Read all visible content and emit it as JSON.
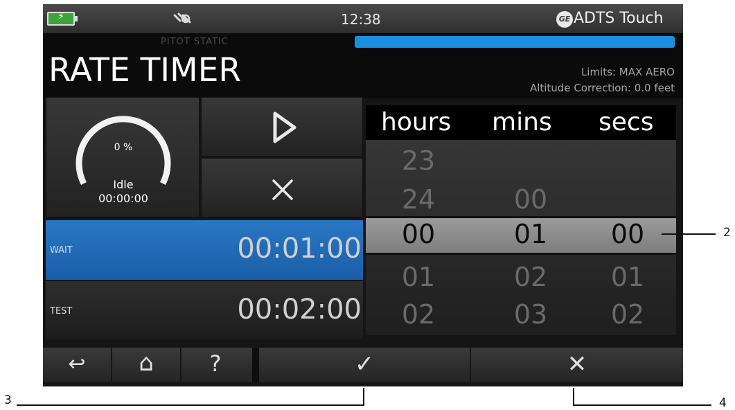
{
  "status_bar": {
    "time": "12:38",
    "device_name": "ADTS Touch",
    "logo_text": "GE"
  },
  "header": {
    "subtitle": "PITOT STATIC",
    "title": "RATE TIMER",
    "limits": "Limits: MAX AERO",
    "altitude_correction": "Altitude Correction: 0.0 feet",
    "progress": 1.0
  },
  "gauge": {
    "percent": "0 %",
    "state": "Idle",
    "elapsed": "00:00:00"
  },
  "controls": {
    "play_glyph": "▷",
    "stop_glyph": "✕"
  },
  "timers": [
    {
      "label": "WAIT",
      "value": "00:01:00"
    },
    {
      "label": "TEST",
      "value": "00:02:00"
    }
  ],
  "picker": {
    "headers": {
      "hours": "hours",
      "mins": "mins",
      "secs": "secs"
    },
    "hours": {
      "above2": "23",
      "above1": "24",
      "selected": "00",
      "below1": "01",
      "below2": "02"
    },
    "mins": {
      "above1": "00",
      "selected": "01",
      "below1": "02",
      "below2": "03"
    },
    "secs": {
      "selected": "00",
      "below1": "01",
      "below2": "02"
    }
  },
  "bottom_bar": {
    "back_glyph": "↩",
    "home_glyph": "⌂",
    "help_glyph": "?",
    "ok_glyph": "✓",
    "cancel_glyph": "✕"
  },
  "callouts": {
    "c2": "2",
    "c3": "3",
    "c4": "4"
  },
  "colors": {
    "accent_blue": "#1a8fe0",
    "wait_row": "#1f66b2"
  }
}
